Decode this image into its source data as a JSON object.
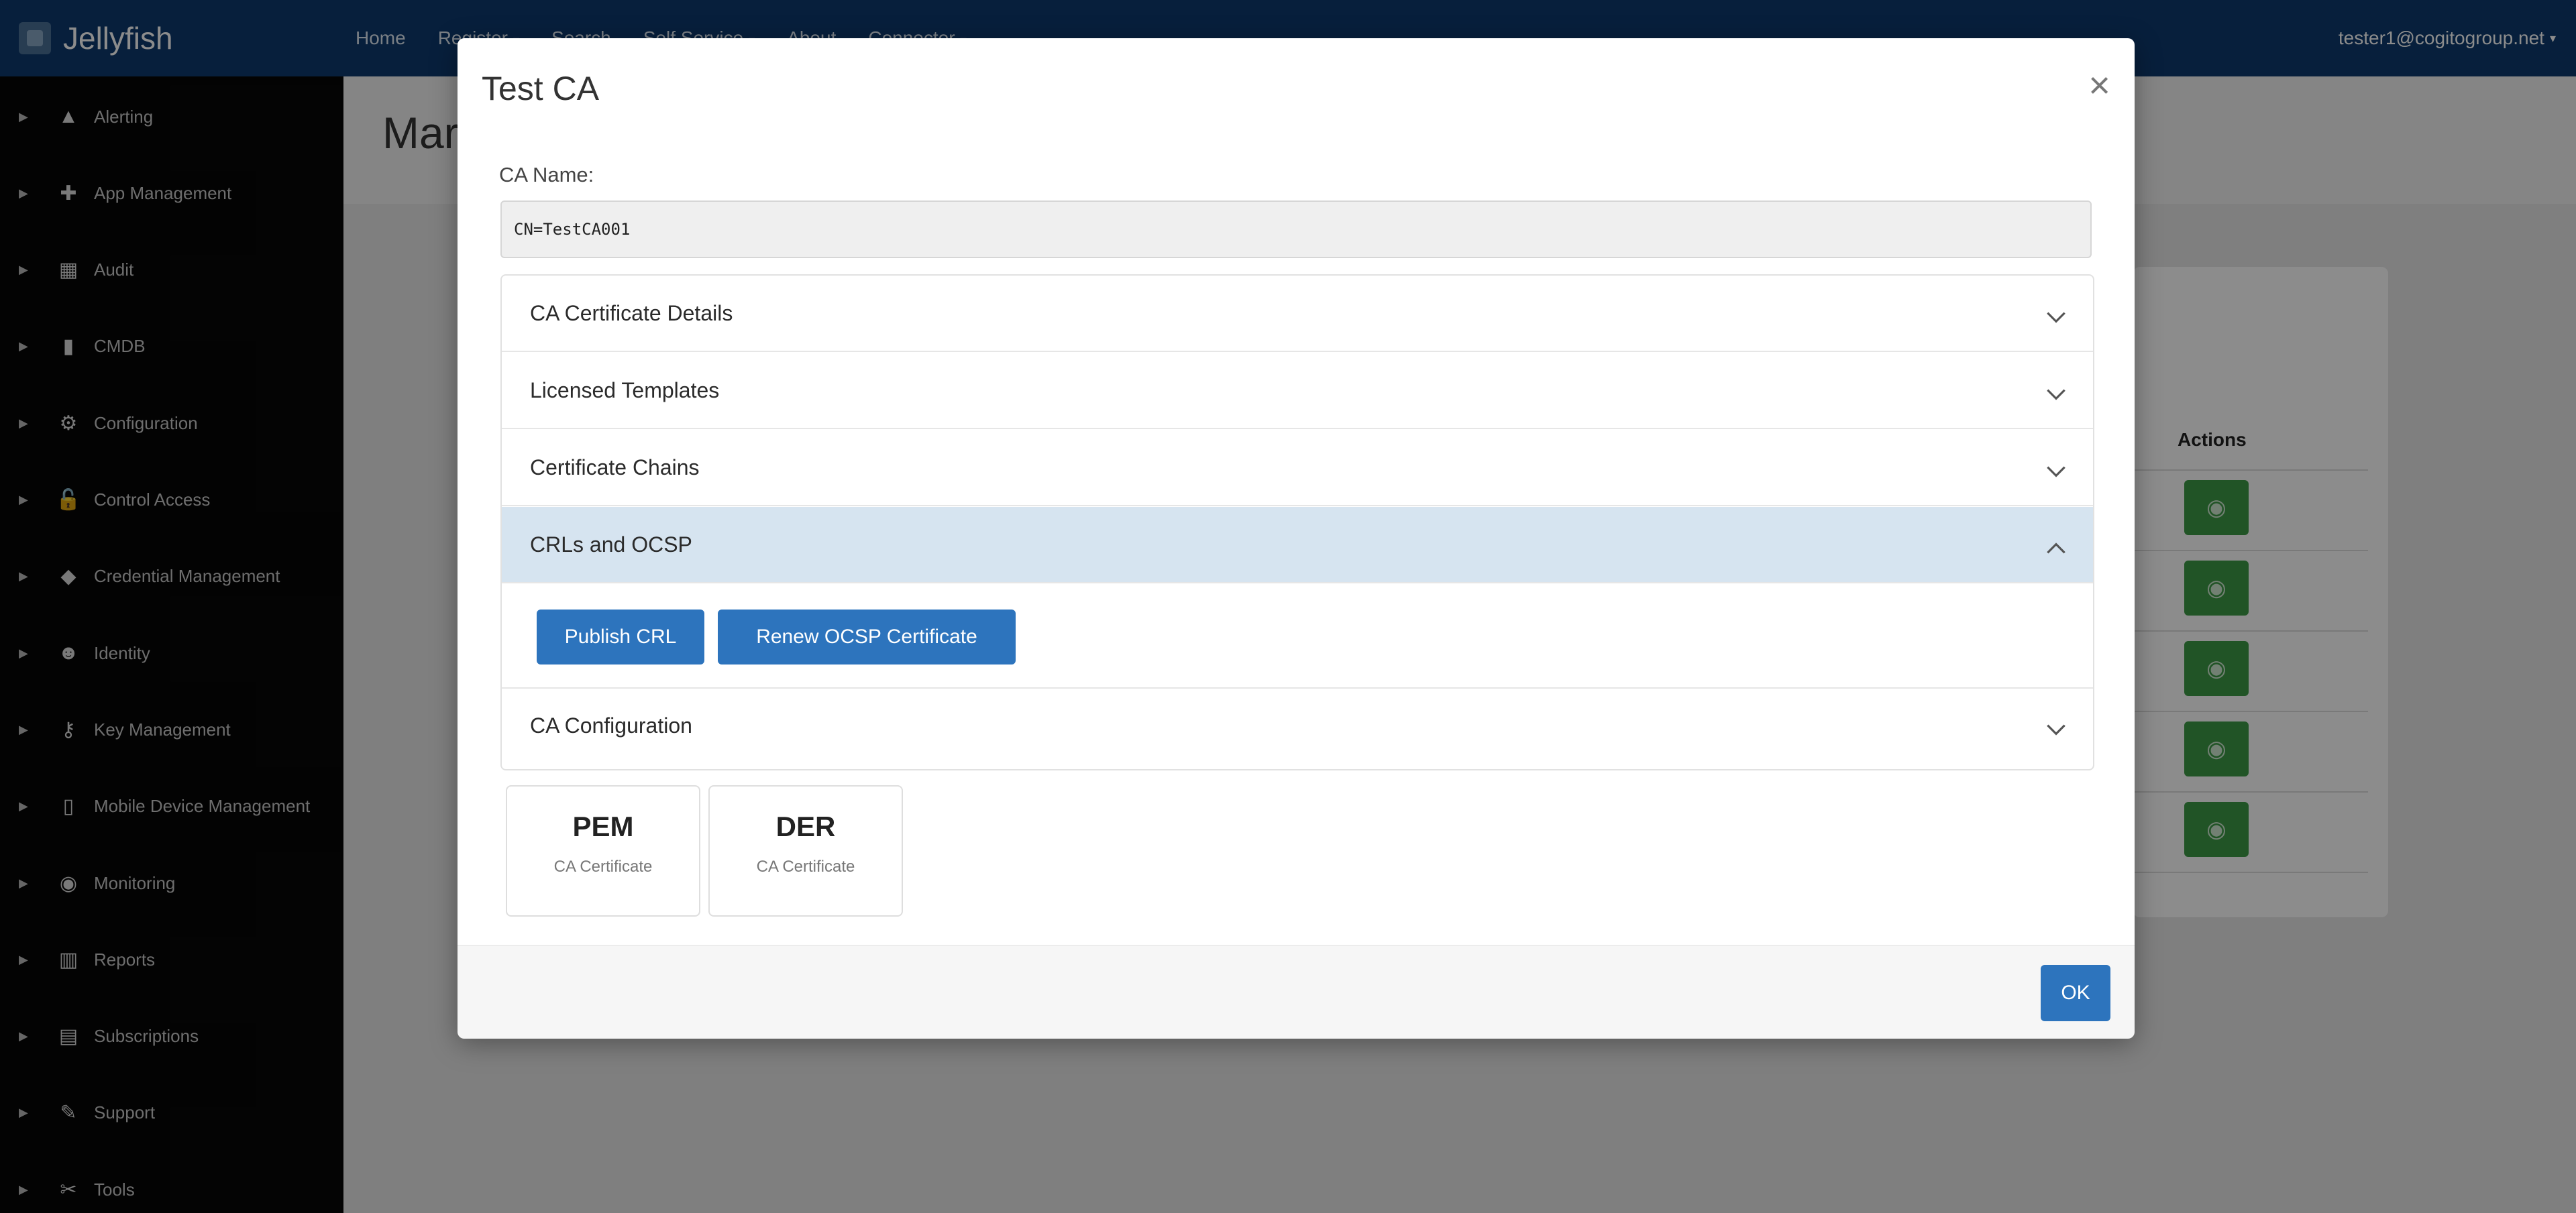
{
  "navbar": {
    "brand": "Jellyfish",
    "links": [
      "Home",
      "Register",
      "Search",
      "Self Service",
      "About",
      "Connector"
    ],
    "user": "tester1@cogitogroup.net"
  },
  "sidebar": {
    "items": [
      {
        "label": "Alerting",
        "icon": "warning-icon"
      },
      {
        "label": "App Management",
        "icon": "puzzle-icon"
      },
      {
        "label": "Audit",
        "icon": "audit-icon"
      },
      {
        "label": "CMDB",
        "icon": "database-icon"
      },
      {
        "label": "Configuration",
        "icon": "gear-icon"
      },
      {
        "label": "Control Access",
        "icon": "lock-icon"
      },
      {
        "label": "Credential Management",
        "icon": "badge-icon"
      },
      {
        "label": "Identity",
        "icon": "users-icon"
      },
      {
        "label": "Key Management",
        "icon": "key-icon"
      },
      {
        "label": "Mobile Device Management",
        "icon": "mobile-icon"
      },
      {
        "label": "Monitoring",
        "icon": "eye-icon"
      },
      {
        "label": "Reports",
        "icon": "chart-icon"
      },
      {
        "label": "Subscriptions",
        "icon": "list-icon"
      },
      {
        "label": "Support",
        "icon": "support-icon"
      },
      {
        "label": "Tools",
        "icon": "wrench-icon"
      }
    ]
  },
  "main": {
    "title": "Mar",
    "actions_header": "Actions"
  },
  "modal": {
    "title": "Test CA",
    "ca_name_label": "CA Name:",
    "ca_name_value": "CN=TestCA001",
    "sections": [
      {
        "label": "CA Certificate Details",
        "open": false
      },
      {
        "label": "Licensed Templates",
        "open": false
      },
      {
        "label": "Certificate Chains",
        "open": false
      },
      {
        "label": "CRLs and OCSP",
        "open": true
      },
      {
        "label": "CA Configuration",
        "open": false
      }
    ],
    "crl_buttons": {
      "publish": "Publish CRL",
      "renew": "Renew OCSP Certificate"
    },
    "downloads": [
      {
        "title": "PEM",
        "subtitle": "CA Certificate"
      },
      {
        "title": "DER",
        "subtitle": "CA Certificate"
      }
    ],
    "ok_label": "OK"
  },
  "colors": {
    "navbar": "#0d3a6e",
    "sidebar": "#070707",
    "primary": "#2d74bd",
    "success": "#3c9a46",
    "open_section": "#d6e4f0"
  }
}
